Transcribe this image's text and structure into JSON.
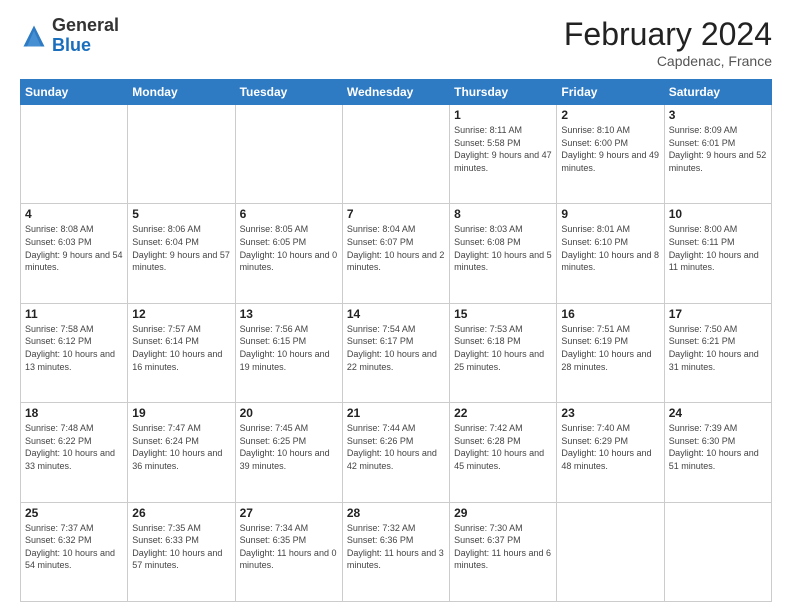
{
  "header": {
    "logo_general": "General",
    "logo_blue": "Blue",
    "title": "February 2024",
    "location": "Capdenac, France"
  },
  "days_of_week": [
    "Sunday",
    "Monday",
    "Tuesday",
    "Wednesday",
    "Thursday",
    "Friday",
    "Saturday"
  ],
  "weeks": [
    [
      {
        "day": "",
        "info": ""
      },
      {
        "day": "",
        "info": ""
      },
      {
        "day": "",
        "info": ""
      },
      {
        "day": "",
        "info": ""
      },
      {
        "day": "1",
        "info": "Sunrise: 8:11 AM\nSunset: 5:58 PM\nDaylight: 9 hours and 47 minutes."
      },
      {
        "day": "2",
        "info": "Sunrise: 8:10 AM\nSunset: 6:00 PM\nDaylight: 9 hours and 49 minutes."
      },
      {
        "day": "3",
        "info": "Sunrise: 8:09 AM\nSunset: 6:01 PM\nDaylight: 9 hours and 52 minutes."
      }
    ],
    [
      {
        "day": "4",
        "info": "Sunrise: 8:08 AM\nSunset: 6:03 PM\nDaylight: 9 hours and 54 minutes."
      },
      {
        "day": "5",
        "info": "Sunrise: 8:06 AM\nSunset: 6:04 PM\nDaylight: 9 hours and 57 minutes."
      },
      {
        "day": "6",
        "info": "Sunrise: 8:05 AM\nSunset: 6:05 PM\nDaylight: 10 hours and 0 minutes."
      },
      {
        "day": "7",
        "info": "Sunrise: 8:04 AM\nSunset: 6:07 PM\nDaylight: 10 hours and 2 minutes."
      },
      {
        "day": "8",
        "info": "Sunrise: 8:03 AM\nSunset: 6:08 PM\nDaylight: 10 hours and 5 minutes."
      },
      {
        "day": "9",
        "info": "Sunrise: 8:01 AM\nSunset: 6:10 PM\nDaylight: 10 hours and 8 minutes."
      },
      {
        "day": "10",
        "info": "Sunrise: 8:00 AM\nSunset: 6:11 PM\nDaylight: 10 hours and 11 minutes."
      }
    ],
    [
      {
        "day": "11",
        "info": "Sunrise: 7:58 AM\nSunset: 6:12 PM\nDaylight: 10 hours and 13 minutes."
      },
      {
        "day": "12",
        "info": "Sunrise: 7:57 AM\nSunset: 6:14 PM\nDaylight: 10 hours and 16 minutes."
      },
      {
        "day": "13",
        "info": "Sunrise: 7:56 AM\nSunset: 6:15 PM\nDaylight: 10 hours and 19 minutes."
      },
      {
        "day": "14",
        "info": "Sunrise: 7:54 AM\nSunset: 6:17 PM\nDaylight: 10 hours and 22 minutes."
      },
      {
        "day": "15",
        "info": "Sunrise: 7:53 AM\nSunset: 6:18 PM\nDaylight: 10 hours and 25 minutes."
      },
      {
        "day": "16",
        "info": "Sunrise: 7:51 AM\nSunset: 6:19 PM\nDaylight: 10 hours and 28 minutes."
      },
      {
        "day": "17",
        "info": "Sunrise: 7:50 AM\nSunset: 6:21 PM\nDaylight: 10 hours and 31 minutes."
      }
    ],
    [
      {
        "day": "18",
        "info": "Sunrise: 7:48 AM\nSunset: 6:22 PM\nDaylight: 10 hours and 33 minutes."
      },
      {
        "day": "19",
        "info": "Sunrise: 7:47 AM\nSunset: 6:24 PM\nDaylight: 10 hours and 36 minutes."
      },
      {
        "day": "20",
        "info": "Sunrise: 7:45 AM\nSunset: 6:25 PM\nDaylight: 10 hours and 39 minutes."
      },
      {
        "day": "21",
        "info": "Sunrise: 7:44 AM\nSunset: 6:26 PM\nDaylight: 10 hours and 42 minutes."
      },
      {
        "day": "22",
        "info": "Sunrise: 7:42 AM\nSunset: 6:28 PM\nDaylight: 10 hours and 45 minutes."
      },
      {
        "day": "23",
        "info": "Sunrise: 7:40 AM\nSunset: 6:29 PM\nDaylight: 10 hours and 48 minutes."
      },
      {
        "day": "24",
        "info": "Sunrise: 7:39 AM\nSunset: 6:30 PM\nDaylight: 10 hours and 51 minutes."
      }
    ],
    [
      {
        "day": "25",
        "info": "Sunrise: 7:37 AM\nSunset: 6:32 PM\nDaylight: 10 hours and 54 minutes."
      },
      {
        "day": "26",
        "info": "Sunrise: 7:35 AM\nSunset: 6:33 PM\nDaylight: 10 hours and 57 minutes."
      },
      {
        "day": "27",
        "info": "Sunrise: 7:34 AM\nSunset: 6:35 PM\nDaylight: 11 hours and 0 minutes."
      },
      {
        "day": "28",
        "info": "Sunrise: 7:32 AM\nSunset: 6:36 PM\nDaylight: 11 hours and 3 minutes."
      },
      {
        "day": "29",
        "info": "Sunrise: 7:30 AM\nSunset: 6:37 PM\nDaylight: 11 hours and 6 minutes."
      },
      {
        "day": "",
        "info": ""
      },
      {
        "day": "",
        "info": ""
      }
    ]
  ]
}
